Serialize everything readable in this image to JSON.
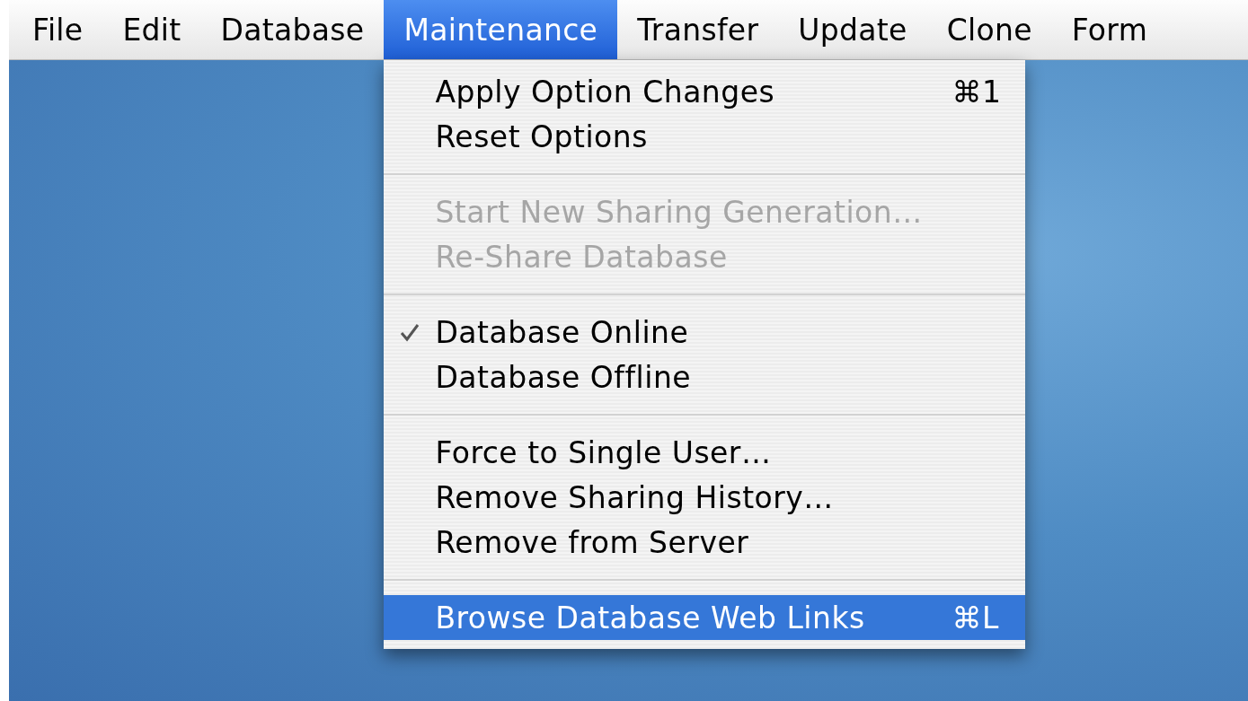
{
  "menubar": [
    {
      "label": "File",
      "selected": false
    },
    {
      "label": "Edit",
      "selected": false
    },
    {
      "label": "Database",
      "selected": false
    },
    {
      "label": "Maintenance",
      "selected": true
    },
    {
      "label": "Transfer",
      "selected": false
    },
    {
      "label": "Update",
      "selected": false
    },
    {
      "label": "Clone",
      "selected": false
    },
    {
      "label": "Form",
      "selected": false
    }
  ],
  "menu": {
    "sections": [
      [
        {
          "label": "Apply Option Changes",
          "shortcut": "⌘1",
          "disabled": false,
          "checked": false,
          "selected": false
        },
        {
          "label": "Reset Options",
          "disabled": false,
          "checked": false,
          "selected": false
        }
      ],
      [
        {
          "label": "Start New Sharing Generation…",
          "disabled": true,
          "checked": false,
          "selected": false
        },
        {
          "label": "Re-Share Database",
          "disabled": true,
          "checked": false,
          "selected": false
        }
      ],
      [
        {
          "label": "Database Online",
          "disabled": false,
          "checked": true,
          "selected": false
        },
        {
          "label": "Database Offline",
          "disabled": false,
          "checked": false,
          "selected": false
        }
      ],
      [
        {
          "label": "Force to Single User…",
          "disabled": false,
          "checked": false,
          "selected": false
        },
        {
          "label": "Remove Sharing History…",
          "disabled": false,
          "checked": false,
          "selected": false
        },
        {
          "label": "Remove from Server",
          "disabled": false,
          "checked": false,
          "selected": false
        }
      ],
      [
        {
          "label": "Browse Database Web Links",
          "shortcut": "⌘L",
          "disabled": false,
          "checked": false,
          "selected": true
        }
      ]
    ]
  }
}
